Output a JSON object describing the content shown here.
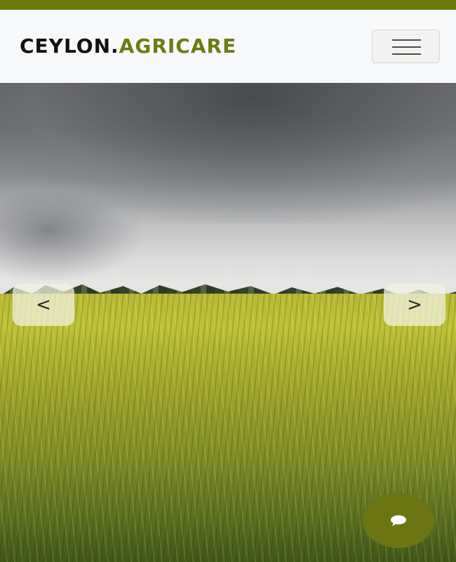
{
  "header": {
    "brand_part1": "CEYLON.",
    "brand_part2": "AGRICARE"
  },
  "hero": {
    "prev_label": "<",
    "next_label": ">"
  },
  "colors": {
    "accent": "#6d7c13",
    "top_strip": "#6b7a0b",
    "fab": "#6b7512"
  },
  "icons": {
    "menu": "hamburger-icon",
    "chat": "chat-bubble-icon"
  }
}
